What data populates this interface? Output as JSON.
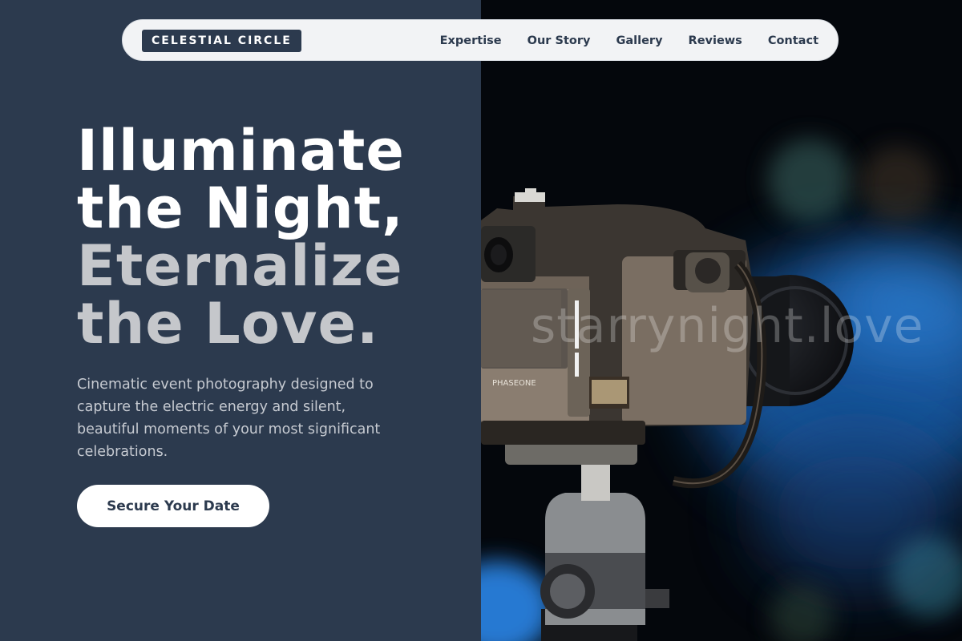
{
  "nav": {
    "logo": "CELESTIAL CIRCLE",
    "links": [
      "Expertise",
      "Our Story",
      "Gallery",
      "Reviews",
      "Contact"
    ]
  },
  "hero": {
    "title_lines": [
      "Illuminate",
      "the Night,",
      "Eternalize",
      "the Love."
    ],
    "description": "Cinematic event photography designed to capture the electric energy and silent, beautiful moments of your most significant celebrations.",
    "cta_label": "Secure Your Date"
  },
  "image": {
    "watermark": "starrynight.love",
    "camera_brand_text": "PHASEONE",
    "subject": "camera-on-tripod"
  },
  "colors": {
    "panel": "#2c3a4e",
    "title_primary": "#ffffff",
    "title_secondary": "#c5c7cb",
    "nav_bg": "#f2f3f5",
    "bokeh_blue": "#1e6fc4"
  }
}
